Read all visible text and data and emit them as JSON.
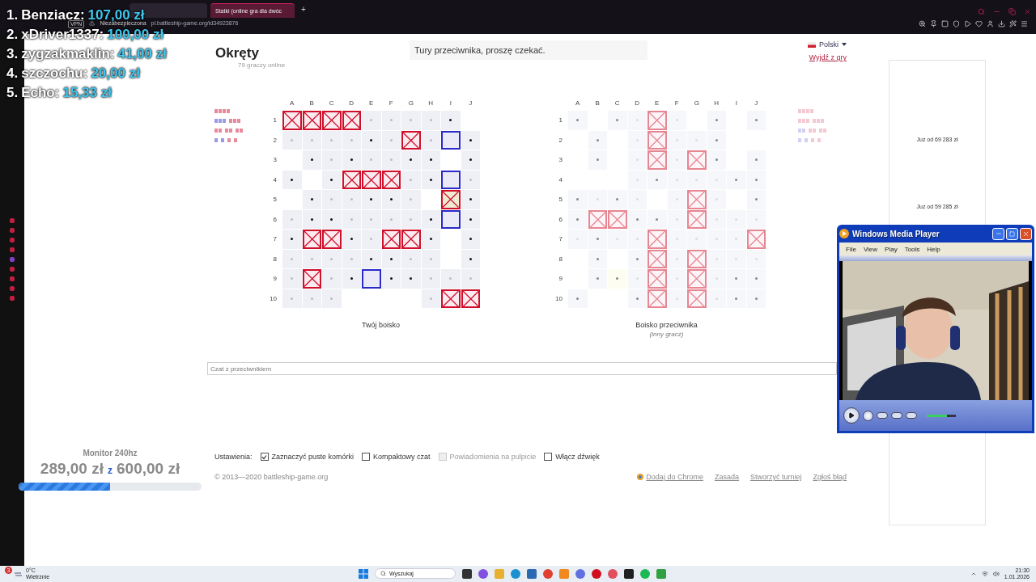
{
  "browser": {
    "tabs": [
      {
        "selected": false
      },
      {
        "label": "Statki (online gra dla dwóc",
        "selected": true
      }
    ],
    "new_tab": "+",
    "vpn": "VPN",
    "security": "Niezabezpieczona",
    "url": "pl.battleship-game.org/id34923876"
  },
  "donations": [
    {
      "rank": "1.",
      "name": "Benziacz:",
      "amount": "107,00 zł"
    },
    {
      "rank": "2.",
      "name": "xDriver1337:",
      "amount": "100,00 zł"
    },
    {
      "rank": "3.",
      "name": "zygzakmaklin:",
      "amount": "41,00 zł"
    },
    {
      "rank": "4.",
      "name": "szczochu:",
      "amount": "20,00 zł"
    },
    {
      "rank": "5.",
      "name": "Echo:",
      "amount": "15,33 zł"
    }
  ],
  "goal": {
    "title": "Monitor 240hz",
    "raised": "289,00 zł",
    "of": "z",
    "target": "600,00 zł",
    "level": 0.5
  },
  "header": {
    "title": "Okręty",
    "online": "79 graczy online",
    "status": "Tury przeciwnika, proszę czekać.",
    "language": "Polski",
    "leave": "Wyjdź z gry"
  },
  "boards": [
    {
      "caption": "Twój boisko",
      "faded": false,
      "columns": [
        "A",
        "B",
        "C",
        "D",
        "E",
        "F",
        "G",
        "H",
        "I",
        "J"
      ],
      "fleet": [
        {
          "ships": [
            {
              "sunk": true
            }
          ]
        },
        {
          "ships": [
            {
              "sunk": false
            },
            {
              "sunk": true
            }
          ]
        },
        {
          "ships": [
            {
              "sunk": true
            },
            {
              "sunk": true
            },
            {
              "sunk": true
            }
          ]
        },
        {
          "ships": [
            {
              "sunk": false
            },
            {
              "sunk": false
            },
            {
              "sunk": true
            },
            {
              "sunk": true
            }
          ]
        }
      ],
      "rows": [
        {
          "label": "1",
          "cells": [
            {
              "kind": "hit"
            },
            {
              "kind": "hit"
            },
            {
              "kind": "hit"
            },
            {
              "kind": "hit"
            },
            {
              "kind": "mark"
            },
            {
              "kind": "mark"
            },
            {
              "kind": "mark"
            },
            {
              "kind": "mark"
            },
            {
              "kind": "shot"
            },
            {
              "kind": "blank"
            }
          ]
        },
        {
          "label": "2",
          "cells": [
            {
              "kind": "mark"
            },
            {
              "kind": "mark"
            },
            {
              "kind": "mark"
            },
            {
              "kind": "mark"
            },
            {
              "kind": "shot"
            },
            {
              "kind": "mark"
            },
            {
              "kind": "hit"
            },
            {
              "kind": "mark"
            },
            {
              "kind": "ship"
            },
            {
              "kind": "shot"
            }
          ]
        },
        {
          "label": "3",
          "cells": [
            {
              "kind": "blank"
            },
            {
              "kind": "shot"
            },
            {
              "kind": "mark"
            },
            {
              "kind": "shot"
            },
            {
              "kind": "mark"
            },
            {
              "kind": "mark"
            },
            {
              "kind": "shot"
            },
            {
              "kind": "shot"
            },
            {
              "kind": "blank"
            },
            {
              "kind": "shot"
            }
          ]
        },
        {
          "label": "4",
          "cells": [
            {
              "kind": "shot"
            },
            {
              "kind": "blank"
            },
            {
              "kind": "shot"
            },
            {
              "kind": "hit"
            },
            {
              "kind": "hit"
            },
            {
              "kind": "hit"
            },
            {
              "kind": "mark"
            },
            {
              "kind": "shot"
            },
            {
              "kind": "ship"
            },
            {
              "kind": "mark"
            }
          ]
        },
        {
          "label": "5",
          "cells": [
            {
              "kind": "blank"
            },
            {
              "kind": "shot"
            },
            {
              "kind": "mark"
            },
            {
              "kind": "mark"
            },
            {
              "kind": "shot"
            },
            {
              "kind": "shot"
            },
            {
              "kind": "mark"
            },
            {
              "kind": "blank"
            },
            {
              "kind": "last"
            },
            {
              "kind": "shot"
            }
          ]
        },
        {
          "label": "6",
          "cells": [
            {
              "kind": "mark"
            },
            {
              "kind": "shot"
            },
            {
              "kind": "shot"
            },
            {
              "kind": "mark"
            },
            {
              "kind": "mark"
            },
            {
              "kind": "mark"
            },
            {
              "kind": "mark"
            },
            {
              "kind": "shot"
            },
            {
              "kind": "ship"
            },
            {
              "kind": "shot"
            }
          ]
        },
        {
          "label": "7",
          "cells": [
            {
              "kind": "shot"
            },
            {
              "kind": "hit"
            },
            {
              "kind": "hit"
            },
            {
              "kind": "shot"
            },
            {
              "kind": "mark"
            },
            {
              "kind": "hit"
            },
            {
              "kind": "hit"
            },
            {
              "kind": "shot"
            },
            {
              "kind": "blank"
            },
            {
              "kind": "shot"
            }
          ]
        },
        {
          "label": "8",
          "cells": [
            {
              "kind": "mark"
            },
            {
              "kind": "mark"
            },
            {
              "kind": "mark"
            },
            {
              "kind": "mark"
            },
            {
              "kind": "shot"
            },
            {
              "kind": "shot"
            },
            {
              "kind": "mark"
            },
            {
              "kind": "mark"
            },
            {
              "kind": "blank"
            },
            {
              "kind": "shot"
            }
          ]
        },
        {
          "label": "9",
          "cells": [
            {
              "kind": "mark"
            },
            {
              "kind": "hit"
            },
            {
              "kind": "mark"
            },
            {
              "kind": "shot"
            },
            {
              "kind": "ship"
            },
            {
              "kind": "shot"
            },
            {
              "kind": "shot"
            },
            {
              "kind": "mark"
            },
            {
              "kind": "mark"
            },
            {
              "kind": "mark"
            }
          ]
        },
        {
          "label": "10",
          "cells": [
            {
              "kind": "mark"
            },
            {
              "kind": "mark"
            },
            {
              "kind": "mark"
            },
            {
              "kind": "blank"
            },
            {
              "kind": "blank"
            },
            {
              "kind": "blank"
            },
            {
              "kind": "blank"
            },
            {
              "kind": "mark"
            },
            {
              "kind": "hit"
            },
            {
              "kind": "hit"
            }
          ]
        }
      ]
    },
    {
      "caption": "Boisko przeciwnika",
      "note": "(inny gracz)",
      "faded": true,
      "columns": [
        "A",
        "B",
        "C",
        "D",
        "E",
        "F",
        "G",
        "H",
        "I",
        "J"
      ],
      "fleet": [
        {
          "ships": [
            {
              "sunk": true
            }
          ]
        },
        {
          "ships": [
            {
              "sunk": true
            },
            {
              "sunk": true
            }
          ]
        },
        {
          "ships": [
            {
              "sunk": false
            },
            {
              "sunk": true
            },
            {
              "sunk": true
            }
          ]
        },
        {
          "ships": [
            {
              "sunk": false
            },
            {
              "sunk": false
            },
            {
              "sunk": true
            },
            {
              "sunk": true
            }
          ]
        }
      ],
      "rows": [
        {
          "label": "1",
          "cells": [
            {
              "kind": "shot"
            },
            {
              "kind": "blank"
            },
            {
              "kind": "shot"
            },
            {
              "kind": "mark"
            },
            {
              "kind": "hit"
            },
            {
              "kind": "mark"
            },
            {
              "kind": "blank"
            },
            {
              "kind": "shot"
            },
            {
              "kind": "blank"
            },
            {
              "kind": "shot"
            }
          ]
        },
        {
          "label": "2",
          "cells": [
            {
              "kind": "blank"
            },
            {
              "kind": "shot"
            },
            {
              "kind": "blank"
            },
            {
              "kind": "mark"
            },
            {
              "kind": "hit"
            },
            {
              "kind": "mark"
            },
            {
              "kind": "mark"
            },
            {
              "kind": "shot"
            },
            {
              "kind": "blank"
            },
            {
              "kind": "blank"
            }
          ]
        },
        {
          "label": "3",
          "cells": [
            {
              "kind": "blank"
            },
            {
              "kind": "shot"
            },
            {
              "kind": "blank"
            },
            {
              "kind": "mark"
            },
            {
              "kind": "hit"
            },
            {
              "kind": "mark"
            },
            {
              "kind": "hit"
            },
            {
              "kind": "shot"
            },
            {
              "kind": "blank"
            },
            {
              "kind": "shot"
            }
          ]
        },
        {
          "label": "4",
          "cells": [
            {
              "kind": "blank"
            },
            {
              "kind": "blank"
            },
            {
              "kind": "blank"
            },
            {
              "kind": "mark"
            },
            {
              "kind": "shot"
            },
            {
              "kind": "mark"
            },
            {
              "kind": "mark"
            },
            {
              "kind": "mark"
            },
            {
              "kind": "shot"
            },
            {
              "kind": "shot"
            }
          ]
        },
        {
          "label": "5",
          "cells": [
            {
              "kind": "shot"
            },
            {
              "kind": "mark"
            },
            {
              "kind": "shot"
            },
            {
              "kind": "mark"
            },
            {
              "kind": "blank"
            },
            {
              "kind": "mark"
            },
            {
              "kind": "hit"
            },
            {
              "kind": "mark"
            },
            {
              "kind": "blank"
            },
            {
              "kind": "shot"
            }
          ]
        },
        {
          "label": "6",
          "cells": [
            {
              "kind": "shot"
            },
            {
              "kind": "hit"
            },
            {
              "kind": "hit"
            },
            {
              "kind": "shot"
            },
            {
              "kind": "shot"
            },
            {
              "kind": "mark"
            },
            {
              "kind": "hit"
            },
            {
              "kind": "mark"
            },
            {
              "kind": "mark"
            },
            {
              "kind": "mark"
            }
          ]
        },
        {
          "label": "7",
          "cells": [
            {
              "kind": "mark"
            },
            {
              "kind": "shot"
            },
            {
              "kind": "mark"
            },
            {
              "kind": "mark"
            },
            {
              "kind": "hit"
            },
            {
              "kind": "mark"
            },
            {
              "kind": "mark"
            },
            {
              "kind": "mark"
            },
            {
              "kind": "mark"
            },
            {
              "kind": "hit"
            }
          ]
        },
        {
          "label": "8",
          "cells": [
            {
              "kind": "blank"
            },
            {
              "kind": "shot"
            },
            {
              "kind": "blank"
            },
            {
              "kind": "shot"
            },
            {
              "kind": "hit"
            },
            {
              "kind": "mark"
            },
            {
              "kind": "hit"
            },
            {
              "kind": "mark"
            },
            {
              "kind": "mark"
            },
            {
              "kind": "mark"
            }
          ]
        },
        {
          "label": "9",
          "cells": [
            {
              "kind": "blank"
            },
            {
              "kind": "shot"
            },
            {
              "kind": "hover"
            },
            {
              "kind": "mark"
            },
            {
              "kind": "hit"
            },
            {
              "kind": "mark"
            },
            {
              "kind": "hit"
            },
            {
              "kind": "mark"
            },
            {
              "kind": "shot"
            },
            {
              "kind": "shot"
            }
          ]
        },
        {
          "label": "10",
          "cells": [
            {
              "kind": "shot"
            },
            {
              "kind": "blank"
            },
            {
              "kind": "blank"
            },
            {
              "kind": "shot"
            },
            {
              "kind": "hit"
            },
            {
              "kind": "mark"
            },
            {
              "kind": "hit"
            },
            {
              "kind": "mark"
            },
            {
              "kind": "shot"
            },
            {
              "kind": "shot"
            }
          ]
        }
      ]
    }
  ],
  "ads": [
    "Juz od 69 283 zł",
    "Juz od 59 285 zł"
  ],
  "chat": {
    "placeholder": "Czat z przeciwnikiem"
  },
  "settings": {
    "label": "Ustawienia:",
    "options": [
      {
        "label": "Zaznaczyć puste komórki",
        "checked": true,
        "disabled": false
      },
      {
        "label": "Kompaktowy czat",
        "checked": false,
        "disabled": false
      },
      {
        "label": "Powiadomienia na pulpicie",
        "checked": false,
        "disabled": true
      },
      {
        "label": "Włącz dźwięk",
        "checked": false,
        "disabled": false
      }
    ]
  },
  "footer": {
    "copyright": "© 2013—2020 battleship-game.org",
    "links": [
      "Dodaj do Chrome",
      "Zasada",
      "Stworzyć turniej",
      "Zgłoś błąd"
    ]
  },
  "player": {
    "title": "Windows Media Player",
    "menu": [
      "File",
      "View",
      "Play",
      "Tools",
      "Help"
    ],
    "volume": {
      "level": 0.7
    }
  },
  "taskbar": {
    "temperature": "0°C",
    "weather": "Wietrznie",
    "badge": "3",
    "search": "Wyszukaj",
    "time": "21:30",
    "date": "1.01.2026"
  }
}
